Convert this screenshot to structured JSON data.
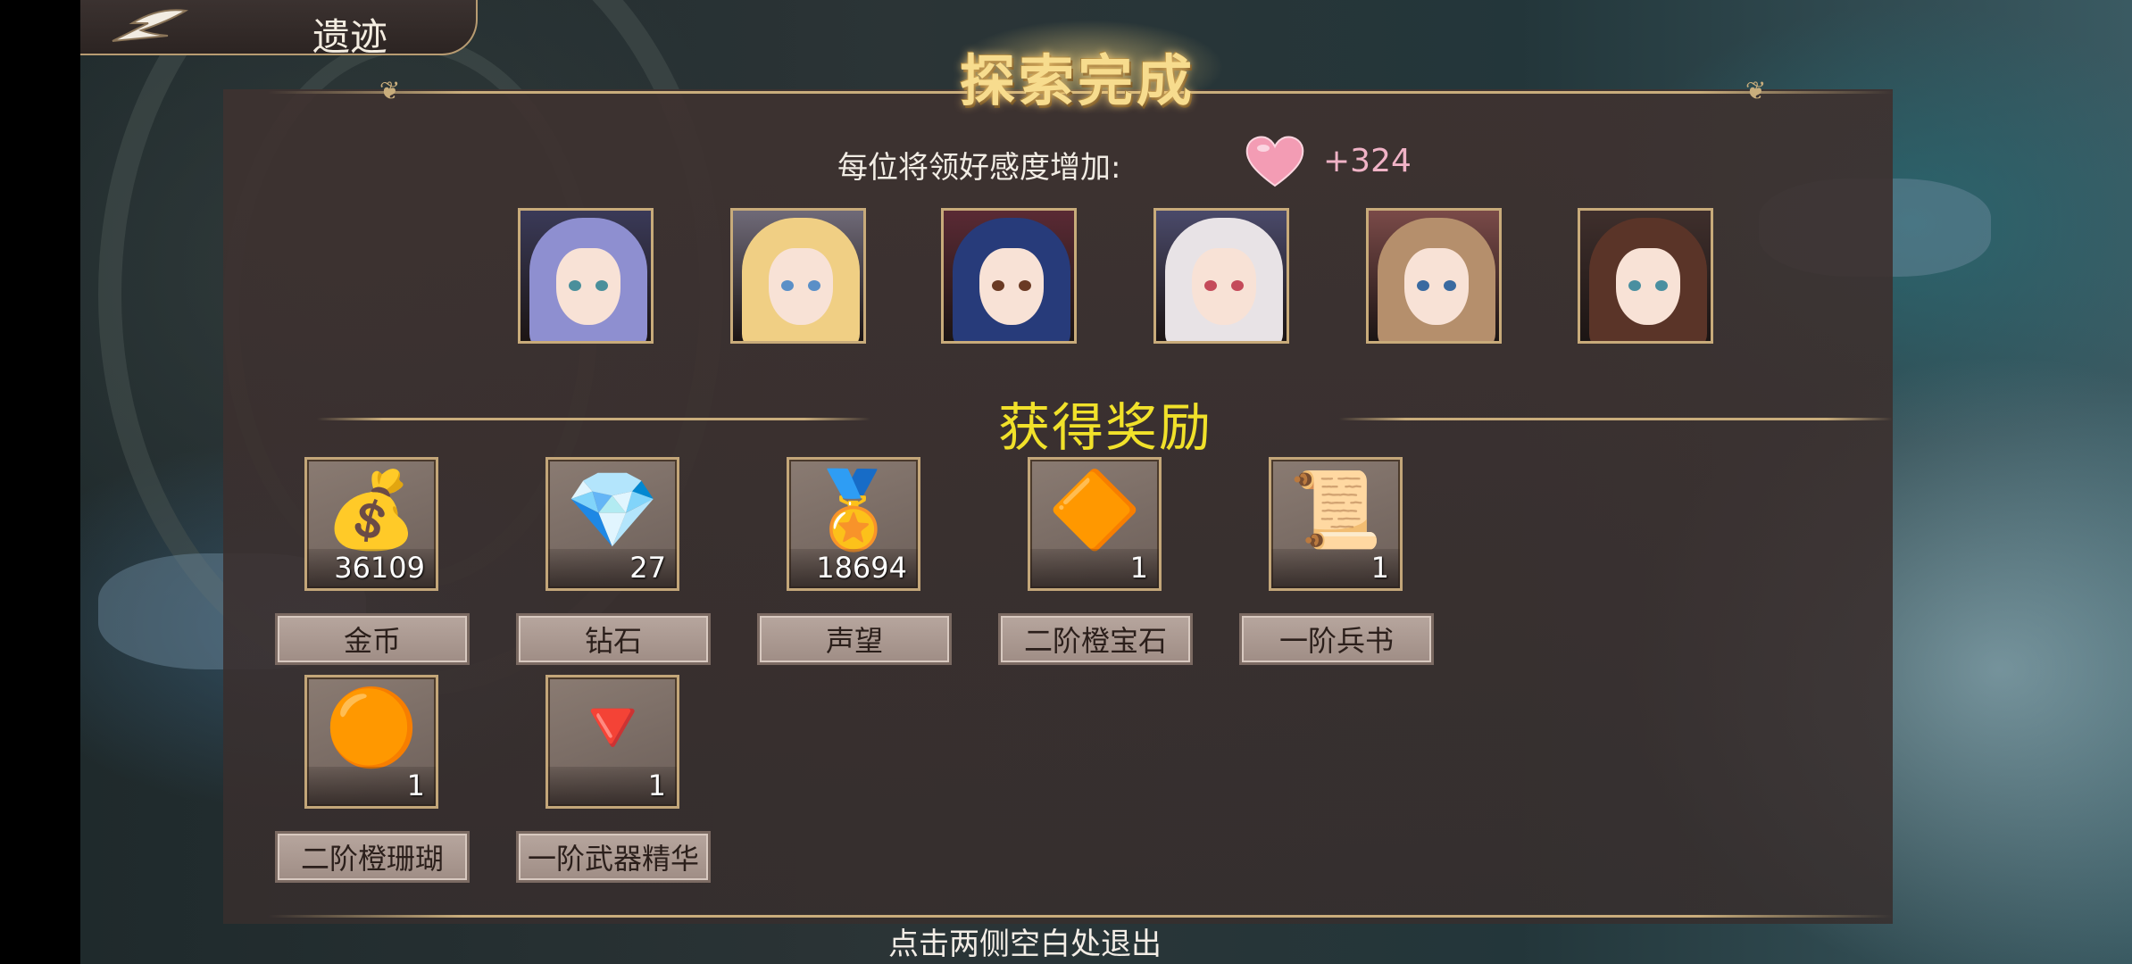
{
  "header": {
    "back_icon": "back-arrow-icon",
    "title": "遗迹"
  },
  "banner": {
    "title": "探索完成"
  },
  "favor": {
    "label": "每位将领好感度增加:",
    "icon": "heart-icon",
    "value": "+324"
  },
  "portraits": [
    {
      "name": "commander-1",
      "hair": "#8e8fd0",
      "bg": "#3a3a58",
      "eye": "#4a8f9b"
    },
    {
      "name": "commander-2",
      "hair": "#f0cf84",
      "bg": "#6f6a78",
      "eye": "#5a8fc7"
    },
    {
      "name": "commander-3",
      "hair": "#273b7a",
      "bg": "#5a2a34",
      "eye": "#6a3a24"
    },
    {
      "name": "commander-4",
      "hair": "#e8e3e6",
      "bg": "#4a4a6a",
      "eye": "#c44a5a"
    },
    {
      "name": "commander-5",
      "hair": "#b58f6c",
      "bg": "#7a4a48",
      "eye": "#3a6aa0"
    },
    {
      "name": "commander-6",
      "hair": "#5a3428",
      "bg": "#3f2f2c",
      "eye": "#4a8fa0"
    }
  ],
  "rewards_title": "获得奖励",
  "rewards": [
    {
      "name": "金币",
      "count": "36109",
      "icon": "treasure-chest-icon",
      "glyph": "💰"
    },
    {
      "name": "钻石",
      "count": "27",
      "icon": "diamond-crystal-icon",
      "glyph": "💎"
    },
    {
      "name": "声望",
      "count": "18694",
      "icon": "reputation-medal-icon",
      "glyph": "🏅"
    },
    {
      "name": "二阶橙宝石",
      "count": "1",
      "icon": "orange-gem-icon",
      "glyph": "🔶"
    },
    {
      "name": "一阶兵书",
      "count": "1",
      "icon": "scroll-icon",
      "glyph": "📜"
    },
    {
      "name": "二阶橙珊瑚",
      "count": "1",
      "icon": "orange-coral-icon",
      "glyph": "🟠"
    },
    {
      "name": "一阶武器精华",
      "count": "1",
      "icon": "weapon-essence-icon",
      "glyph": "🔻"
    }
  ],
  "footer": {
    "exit_hint": "点击两侧空白处退出"
  }
}
